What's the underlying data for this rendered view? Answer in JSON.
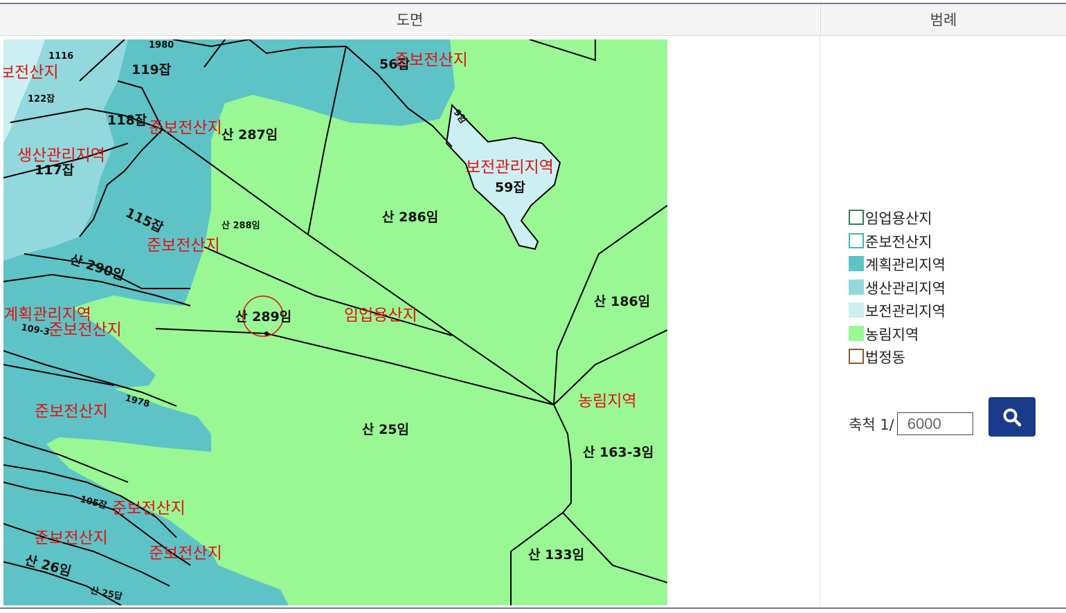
{
  "headers": {
    "map": "도면",
    "legend": "범례"
  },
  "legend": {
    "items": [
      {
        "label": "임업용산지",
        "fill": "#ffffff",
        "border": "#2e7d5b"
      },
      {
        "label": "준보전산지",
        "fill": "#ffffff",
        "border": "#3fb9b0"
      },
      {
        "label": "계획관리지역",
        "fill": "#5ec3c6",
        "border": "#5ec3c6"
      },
      {
        "label": "생산관리지역",
        "fill": "#92d8dd",
        "border": "#92d8dd"
      },
      {
        "label": "보전관리지역",
        "fill": "#ccf0f2",
        "border": "#ccf0f2"
      },
      {
        "label": "농림지역",
        "fill": "#99f794",
        "border": "#99f794"
      },
      {
        "label": "법정동",
        "fill": "#ffffff",
        "border": "#8b5a2b"
      }
    ]
  },
  "scale": {
    "label": "축척 1/",
    "value": "6000"
  },
  "search_icon": "search-icon",
  "colors": {
    "agri": "#99f794",
    "planning": "#5ec3c6",
    "production": "#92d8dd",
    "conservation": "#ccf0f2",
    "zone_text": "#e3110f",
    "button": "#1a3a8a"
  },
  "map": {
    "parcels": [
      "119잡",
      "122잡",
      "118잡",
      "117잡",
      "115잡",
      "56잡",
      "59잡",
      "산 287임",
      "산 288임",
      "산 286임",
      "산 290임",
      "산 289임",
      "산 186임",
      "산 25임",
      "산 163-3임",
      "산 133임",
      "산 26임",
      "109-3",
      "105잡",
      "1978",
      "1980",
      "1116",
      "9임",
      "산 25답"
    ],
    "zones": [
      "보전산지",
      "준보전산지",
      "준보전산지",
      "생산관리지역",
      "보전관리지역",
      "준보전산지",
      "계획관리지역",
      "준보전산지",
      "임업용산지",
      "농림지역",
      "준보전산지",
      "준보전산지",
      "준보전산지",
      "준보전산지"
    ]
  }
}
